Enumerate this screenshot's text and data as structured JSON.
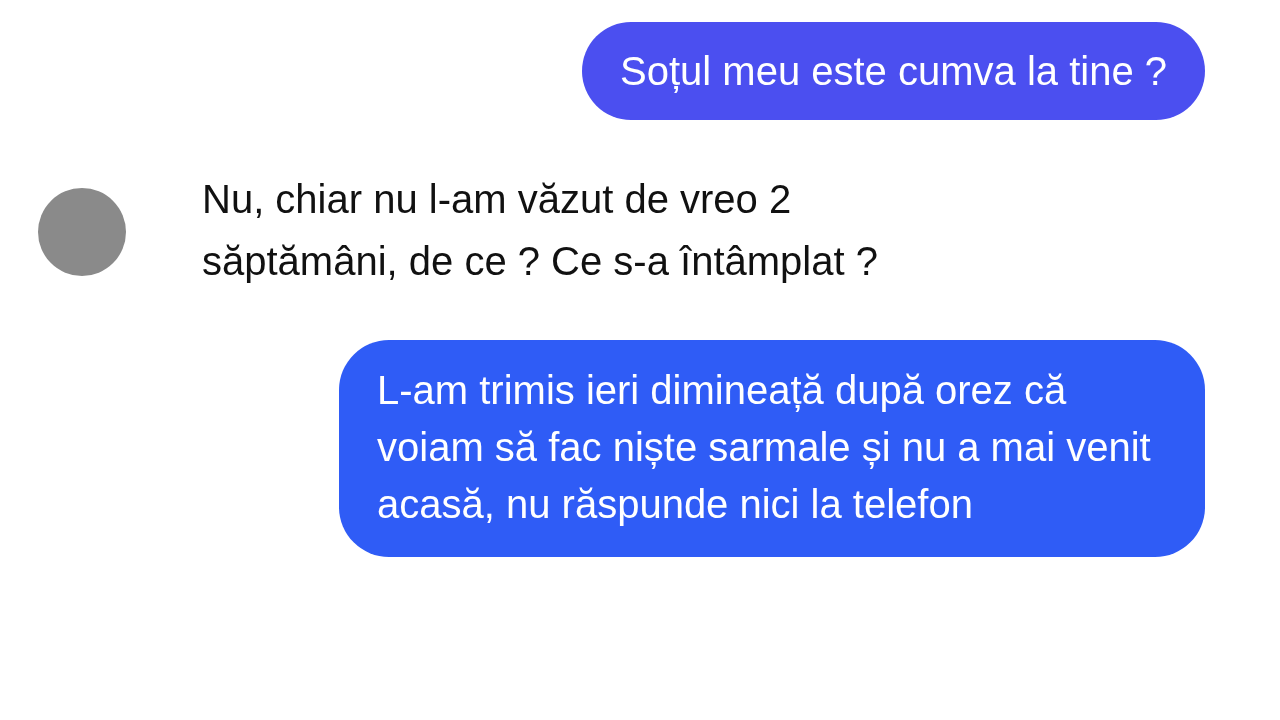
{
  "messages": [
    {
      "kind": "sent",
      "color": "#4b4ff0",
      "text": "Soțul meu este cumva la tine ?"
    },
    {
      "kind": "received",
      "text": "Nu, chiar nu l-am văzut de vreo 2 săptămâni, de ce ? Ce s-a întâmplat ?"
    },
    {
      "kind": "sent",
      "color": "#2f5cf6",
      "text": "L-am trimis ieri dimineață după orez că voiam să fac niște sarmale și nu a mai venit acasă, nu răspunde nici la telefon"
    }
  ]
}
